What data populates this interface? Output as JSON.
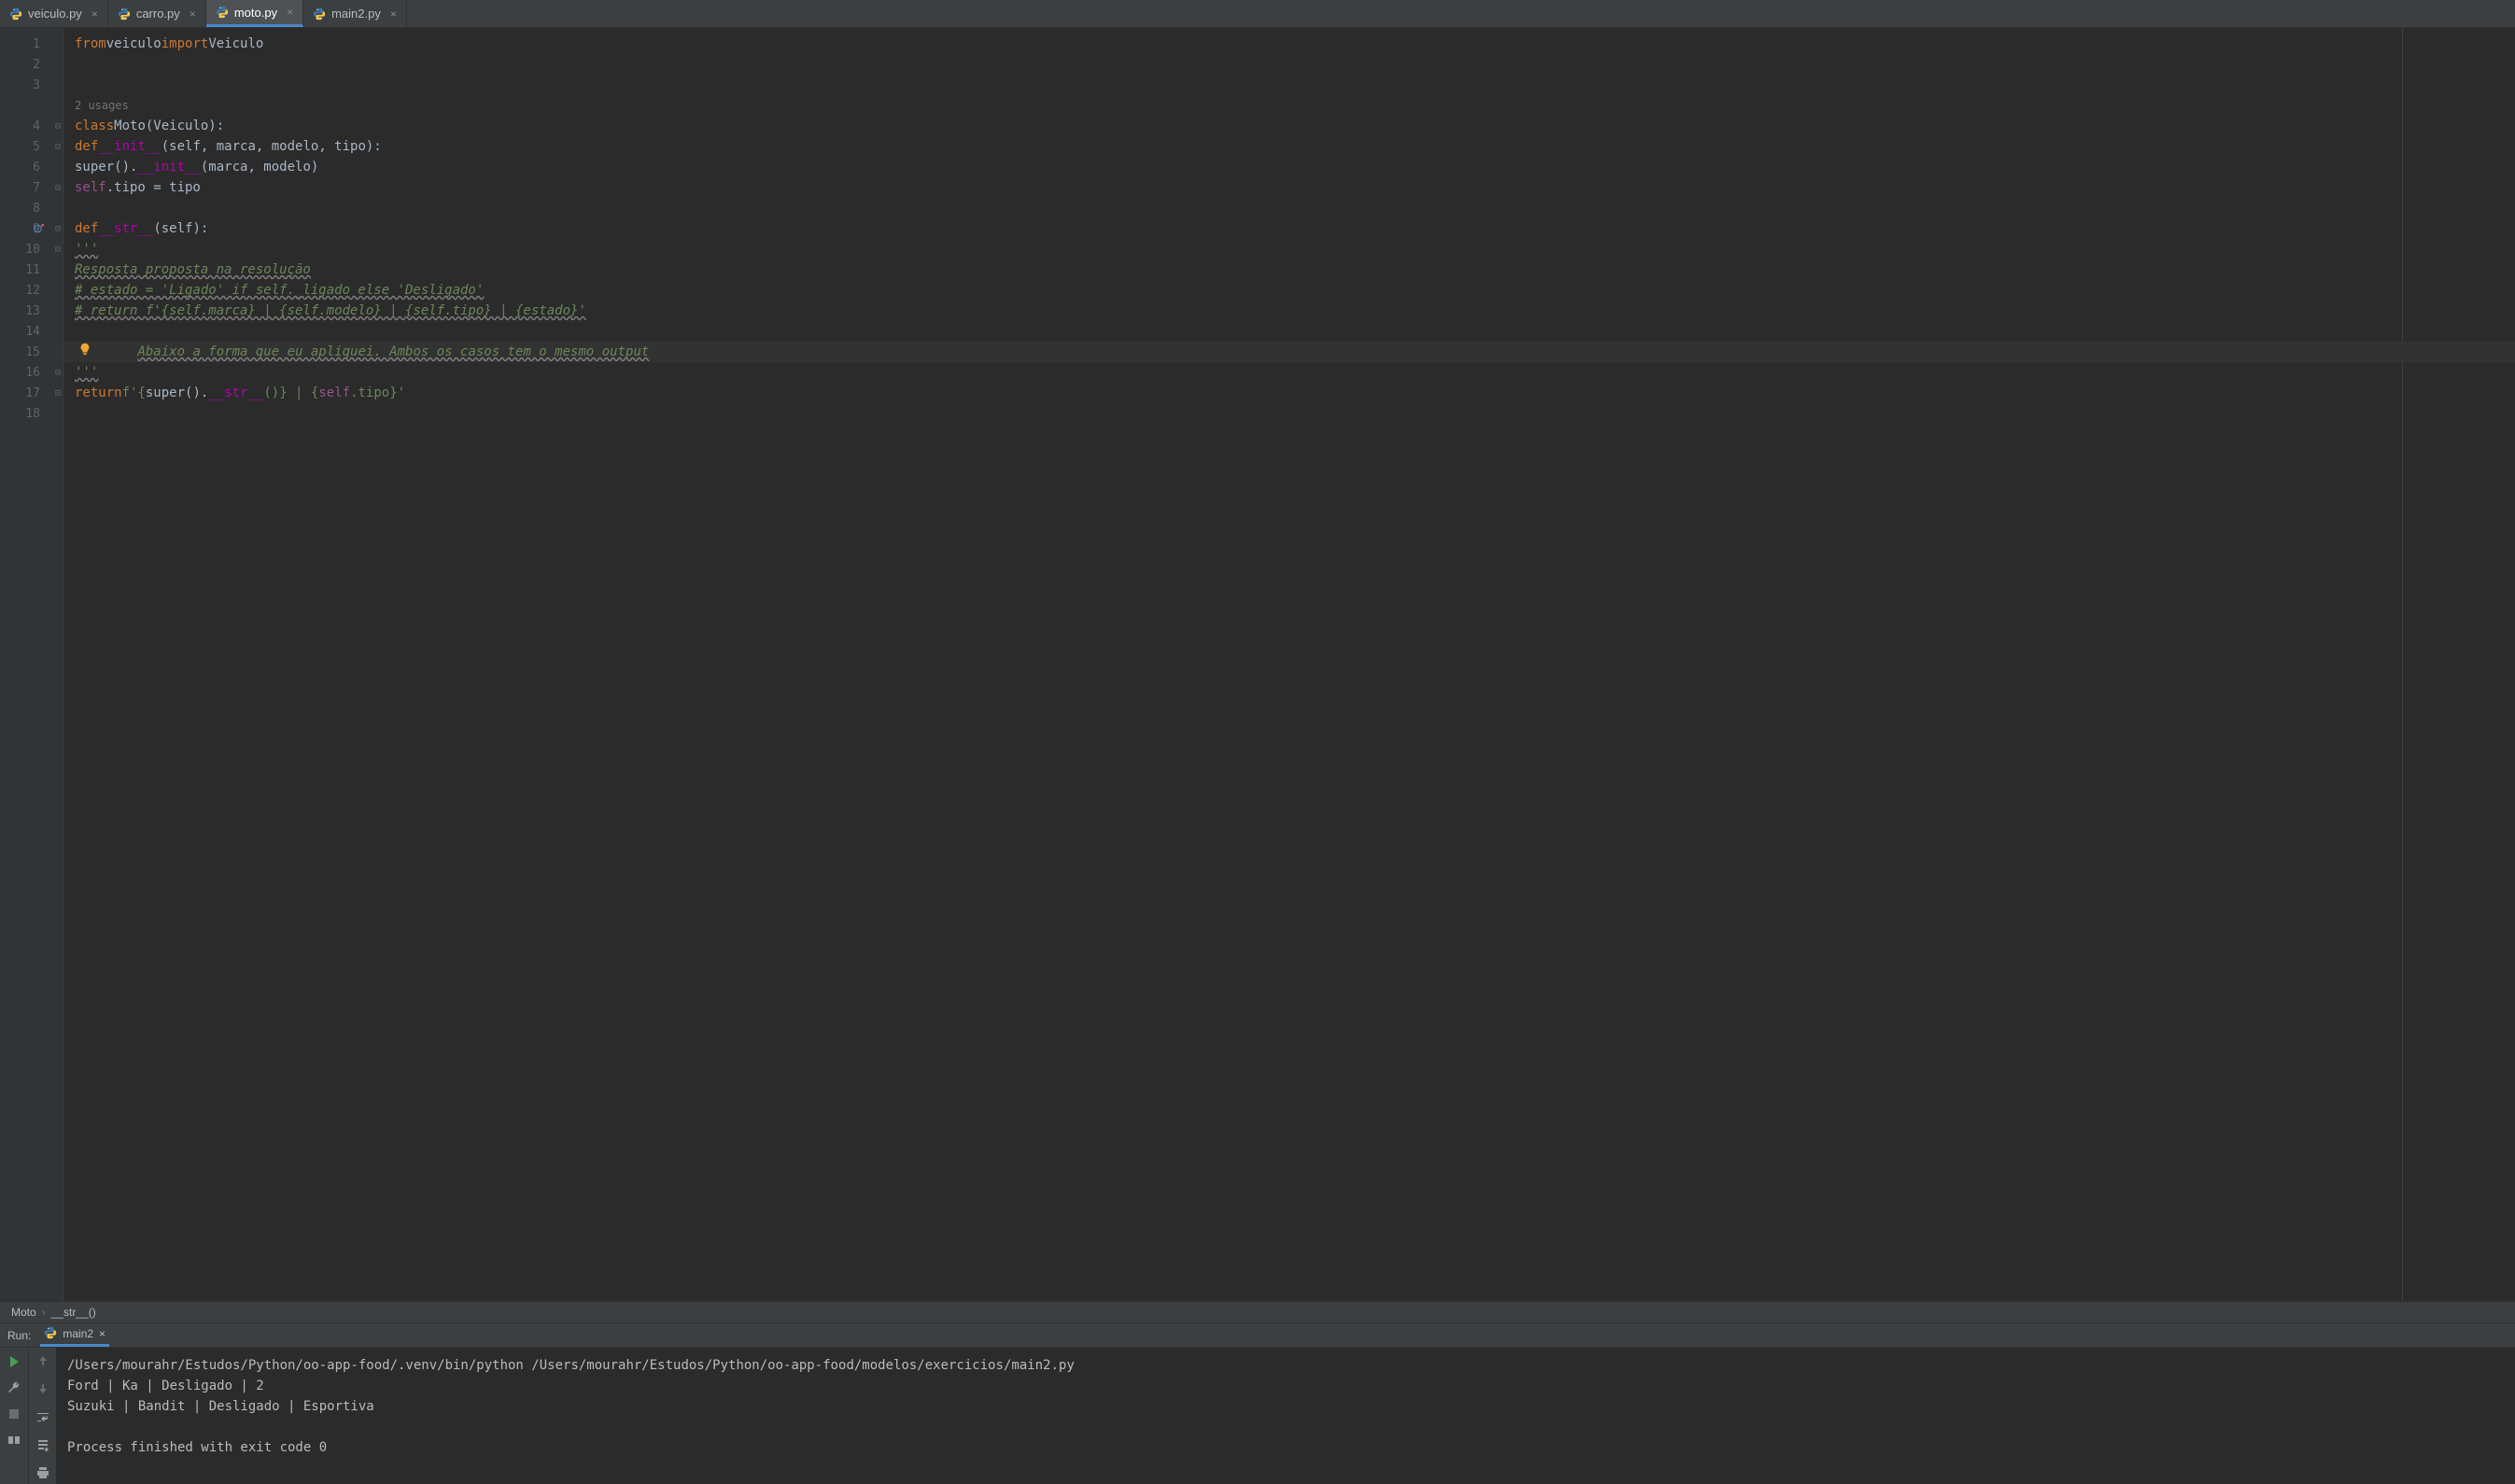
{
  "tabs": [
    {
      "label": "veiculo.py",
      "active": false
    },
    {
      "label": "carro.py",
      "active": false
    },
    {
      "label": "moto.py",
      "active": true
    },
    {
      "label": "main2.py",
      "active": false
    }
  ],
  "usages_hint": "2 usages",
  "code": {
    "l1_from": "from",
    "l1_mod": "veiculo",
    "l1_import": "import",
    "l1_cls": "Veiculo",
    "l4_class": "class",
    "l4_name": "Moto",
    "l4_paren": "(Veiculo):",
    "l5_def": "def",
    "l5_fn": "__init__",
    "l5_args": "(self, marca, modelo, tipo):",
    "l6": "super().",
    "l6_fn": "__init__",
    "l6_args": "(marca, modelo)",
    "l7_self": "self",
    "l7_rest": ".tipo = tipo",
    "l9_def": "def",
    "l9_fn": "__str__",
    "l9_args": "(self):",
    "l10": "'''",
    "l11": "Resposta proposta na resolução",
    "l12": "# estado = 'Ligado' if self._ligado else 'Desligado'",
    "l13": "# return f'{self.marca} | {self.modelo} | {self.tipo} | {estado}'",
    "l15": "Abaixo a forma que eu apliquei. Ambos os casos tem o mesmo output",
    "l16": "'''",
    "l17_ret": "return",
    "l17_f": "f'{",
    "l17_sup": "super()",
    "l17_dot": ".",
    "l17_str": "__str__",
    "l17_mid": "()} | {",
    "l17_self": "self",
    "l17_end": ".tipo}'"
  },
  "line_numbers": [
    "1",
    "2",
    "3",
    "4",
    "5",
    "6",
    "7",
    "8",
    "9",
    "10",
    "11",
    "12",
    "13",
    "14",
    "15",
    "16",
    "17",
    "18"
  ],
  "breadcrumb": {
    "class": "Moto",
    "method": "__str__()"
  },
  "run": {
    "label": "Run:",
    "tab": "main2",
    "output_lines": [
      "/Users/mourahr/Estudos/Python/oo-app-food/.venv/bin/python /Users/mourahr/Estudos/Python/oo-app-food/modelos/exercicios/main2.py",
      "Ford | Ka | Desligado | 2",
      "Suzuki | Bandit | Desligado | Esportiva",
      "",
      "Process finished with exit code 0"
    ]
  }
}
